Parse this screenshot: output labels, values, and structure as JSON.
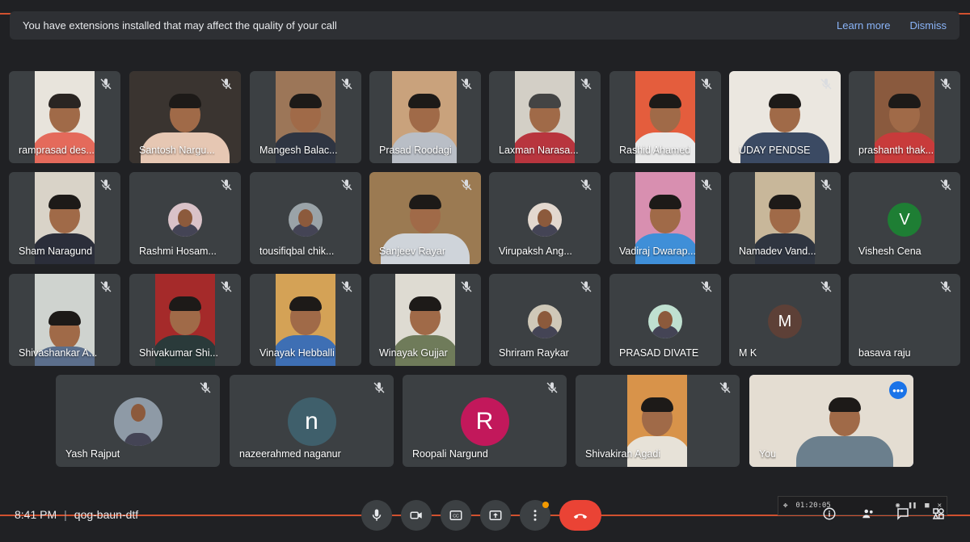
{
  "banner": {
    "message": "You have extensions installed that may affect the quality of your call",
    "learn_more": "Learn more",
    "dismiss": "Dismiss"
  },
  "meeting": {
    "time": "8:41 PM",
    "code": "qog-baun-dtf"
  },
  "recorder": {
    "elapsed": "01:20:05"
  },
  "colors": {
    "background": "#202124",
    "tile": "#3c4043",
    "accent": "#8ab4f8",
    "hangup": "#ea4335",
    "recording_line": "#d1512f"
  },
  "participants": {
    "row1": [
      {
        "name": "ramprasad des..."
      },
      {
        "name": "Santosh Nargu..."
      },
      {
        "name": "Mangesh Balac..."
      },
      {
        "name": "Prasad Roodagi"
      },
      {
        "name": "Laxman Narasa..."
      },
      {
        "name": "Rashid Ahamed"
      },
      {
        "name": "UDAY PENDSE"
      },
      {
        "name": "prashanth thak..."
      }
    ],
    "row2": [
      {
        "name": "Sham Naragund"
      },
      {
        "name": "Rashmi Hosam..."
      },
      {
        "name": "tousifiqbal chik..."
      },
      {
        "name": "Sanjeev Rayar"
      },
      {
        "name": "Virupaksh Ang..."
      },
      {
        "name": "Vadiraj Dwarap..."
      },
      {
        "name": "Namadev Vand..."
      },
      {
        "name": "Vishesh Cena",
        "initial": "V",
        "avatar_color": "#1e7e34"
      }
    ],
    "row3": [
      {
        "name": "Shivashankar A..."
      },
      {
        "name": "Shivakumar Shi..."
      },
      {
        "name": "Vinayak Hebballi"
      },
      {
        "name": "Winayak Gujjar"
      },
      {
        "name": "Shriram Raykar"
      },
      {
        "name": "PRASAD DIVATE"
      },
      {
        "name": "M K",
        "initial": "M",
        "avatar_color": "#5d4037"
      },
      {
        "name": "basava raju"
      }
    ],
    "row4": [
      {
        "name": "Yash Rajput"
      },
      {
        "name": "nazeerahmed naganur",
        "initial": "n",
        "avatar_color": "#3f5f6b"
      },
      {
        "name": "Roopali Nargund",
        "initial": "R",
        "avatar_color": "#c2185b"
      },
      {
        "name": "Shivakiran Agadi"
      },
      {
        "name": "You"
      }
    ]
  },
  "controls": {
    "more_badge": "•••",
    "icons": [
      "microphone-icon",
      "camera-icon",
      "captions-icon",
      "present-icon",
      "more-options-icon",
      "hang-up-icon"
    ]
  }
}
